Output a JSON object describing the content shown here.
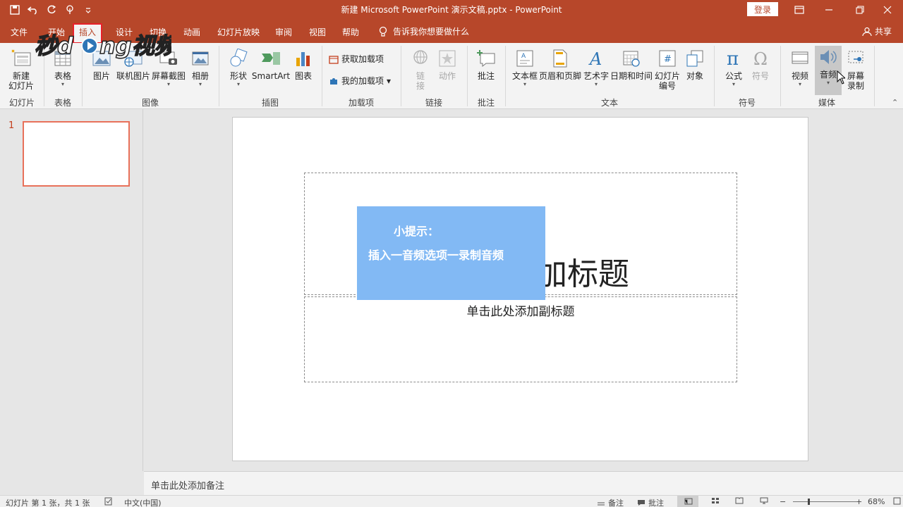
{
  "window": {
    "title": "新建 Microsoft PowerPoint 演示文稿.pptx  -  PowerPoint",
    "login_label": "登录"
  },
  "tabs": [
    {
      "label": "文件"
    },
    {
      "label": "开始"
    },
    {
      "label": "插入",
      "active": true
    },
    {
      "label": "设计"
    },
    {
      "label": "切换"
    },
    {
      "label": "动画"
    },
    {
      "label": "幻灯片放映"
    },
    {
      "label": "审阅"
    },
    {
      "label": "视图"
    },
    {
      "label": "帮助"
    }
  ],
  "tell_me": "告诉我你想要做什么",
  "share_label": "共享",
  "ribbon": {
    "groups": {
      "slides": "幻灯片",
      "tables": "表格",
      "images": "图像",
      "illustrations": "插图",
      "addins": "加载项",
      "links": "链接",
      "comments": "批注",
      "text": "文本",
      "symbols": "符号",
      "media": "媒体"
    },
    "buttons": {
      "new_slide_1": "新建",
      "new_slide_2": "幻灯片",
      "table": "表格",
      "picture": "图片",
      "online_pictures": "联机图片",
      "screenshot": "屏幕截图",
      "album": "相册",
      "shapes": "形状",
      "smartart": "SmartArt",
      "chart": "图表",
      "get_addins": "获取加载项",
      "my_addins": "我的加载项",
      "link_1": "链",
      "link_2": "接",
      "action": "动作",
      "comment": "批注",
      "textbox": "文本框",
      "header_footer": "页眉和页脚",
      "wordart": "艺术字",
      "date_time": "日期和时间",
      "slide_number_1": "幻灯片",
      "slide_number_2": "编号",
      "object": "对象",
      "equation": "公式",
      "symbol": "符号",
      "video": "视频",
      "audio": "音频",
      "screen_record_1": "屏幕",
      "screen_record_2": "录制"
    }
  },
  "thumbnails": [
    {
      "number": "1"
    }
  ],
  "slide": {
    "title_placeholder": "单击此处添加标题",
    "title_visible_part": "添加标题",
    "subtitle_placeholder": "单击此处添加副标题"
  },
  "tip": {
    "line1": "小提示：",
    "line2": "插入一音频选项一录制音频"
  },
  "notes_placeholder": "单击此处添加备注",
  "status": {
    "slide_count": "幻灯片 第 1 张，共 1 张",
    "language": "中文(中国)",
    "notes": "备注",
    "comments": "批注",
    "zoom": "68%"
  },
  "colors": {
    "accent": "#b7472a",
    "tip_bg": "#82b9f4",
    "highlight": "#e8202a"
  }
}
